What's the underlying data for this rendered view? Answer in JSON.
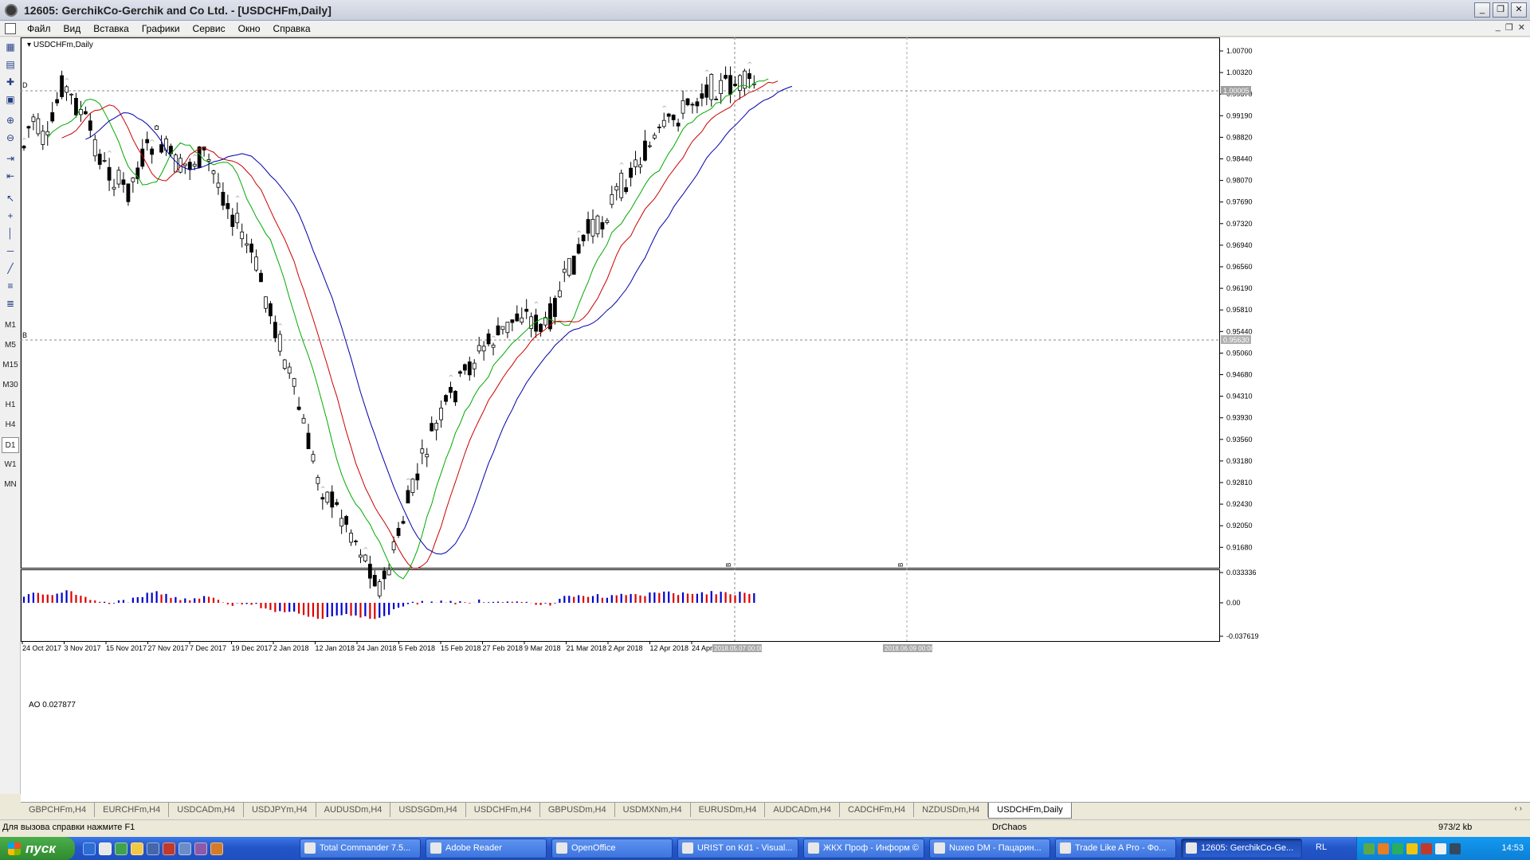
{
  "window": {
    "title": "12605: GerchikCo-Gerchik and Co Ltd. - [USDCHFm,Daily]",
    "buttons": {
      "minimize": "_",
      "restore": "❐",
      "close": "✕"
    }
  },
  "menu": [
    "Файл",
    "Вид",
    "Вставка",
    "Графики",
    "Сервис",
    "Окно",
    "Справка"
  ],
  "toolbar_timeframes": [
    "M1",
    "M5",
    "M15",
    "M30",
    "H1",
    "H4",
    "D1",
    "W1",
    "MN"
  ],
  "toolbar_active_timeframe": "D1",
  "chart": {
    "symbol_label": "USDCHFm,Daily",
    "level_marker_top": "D",
    "level_marker_bottom": "B",
    "price_ticks": [
      "1.00700",
      "1.00320",
      "0.99570",
      "0.99190",
      "0.98820",
      "0.98440",
      "0.98070",
      "0.97690",
      "0.97320",
      "0.96940",
      "0.96560",
      "0.96190",
      "0.95810",
      "0.95440",
      "0.95060",
      "0.94680",
      "0.94310",
      "0.93930",
      "0.93560",
      "0.93180",
      "0.92810",
      "0.92430",
      "0.92050",
      "0.91680"
    ],
    "current_price_label": "1.00005",
    "level_price_label": "0.95630",
    "date_ticks": [
      "24 Oct 2017",
      "3 Nov 2017",
      "15 Nov 2017",
      "27 Nov 2017",
      "7 Dec 2017",
      "19 Dec 2017",
      "2 Jan 2018",
      "12 Jan 2018",
      "24 Jan 2018",
      "5 Feb 2018",
      "15 Feb 2018",
      "27 Feb 2018",
      "9 Mar 2018",
      "21 Mar 2018",
      "2 Apr 2018",
      "12 Apr 2018",
      "24 Apr 2"
    ],
    "crosshair_date_label": "2018.05.07 00:00",
    "future_date_label": "2018.06.09 00:00",
    "vertical_marker": "B"
  },
  "ao": {
    "label": "AO 0.027877",
    "ticks": [
      "0.033336",
      "0.00",
      "-0.037619"
    ]
  },
  "colors": {
    "ao_up": "#0000cc",
    "ao_down": "#dd0000",
    "ma_fast": "#00aa00",
    "ma_mid": "#cc0000",
    "ma_slow": "#0000aa",
    "candle_up": "#ffffff",
    "candle_down": "#000000"
  },
  "tabs": [
    "GBPCHFm,H4",
    "EURCHFm,H4",
    "USDCADm,H4",
    "USDJPYm,H4",
    "AUDUSDm,H4",
    "USDSGDm,H4",
    "USDCHFm,H4",
    "GBPUSDm,H4",
    "USDMXNm,H4",
    "EURUSDm,H4",
    "AUDCADm,H4",
    "CADCHFm,H4",
    "NZDUSDm,H4",
    "USDCHFm,Daily"
  ],
  "active_tab": "USDCHFm,Daily",
  "status": {
    "help": "Для вызова справки нажмите F1",
    "profile": "DrChaos",
    "traffic": "973/2 kb"
  },
  "taskbar": {
    "start_label": "пуск",
    "tasks": [
      "Total Commander 7.5...",
      "Adobe Reader",
      "OpenOffice",
      "URIST on Kd1 - Visual...",
      "ЖКХ Проф - Информ ©",
      "Nuxeo DM - Пацарин...",
      "Trade Like A Pro - Фо...",
      "12605: GerchikCo-Ge..."
    ],
    "active_task": "12605: GerchikCo-Ge...",
    "language": "RL",
    "clock": "14:53"
  }
}
